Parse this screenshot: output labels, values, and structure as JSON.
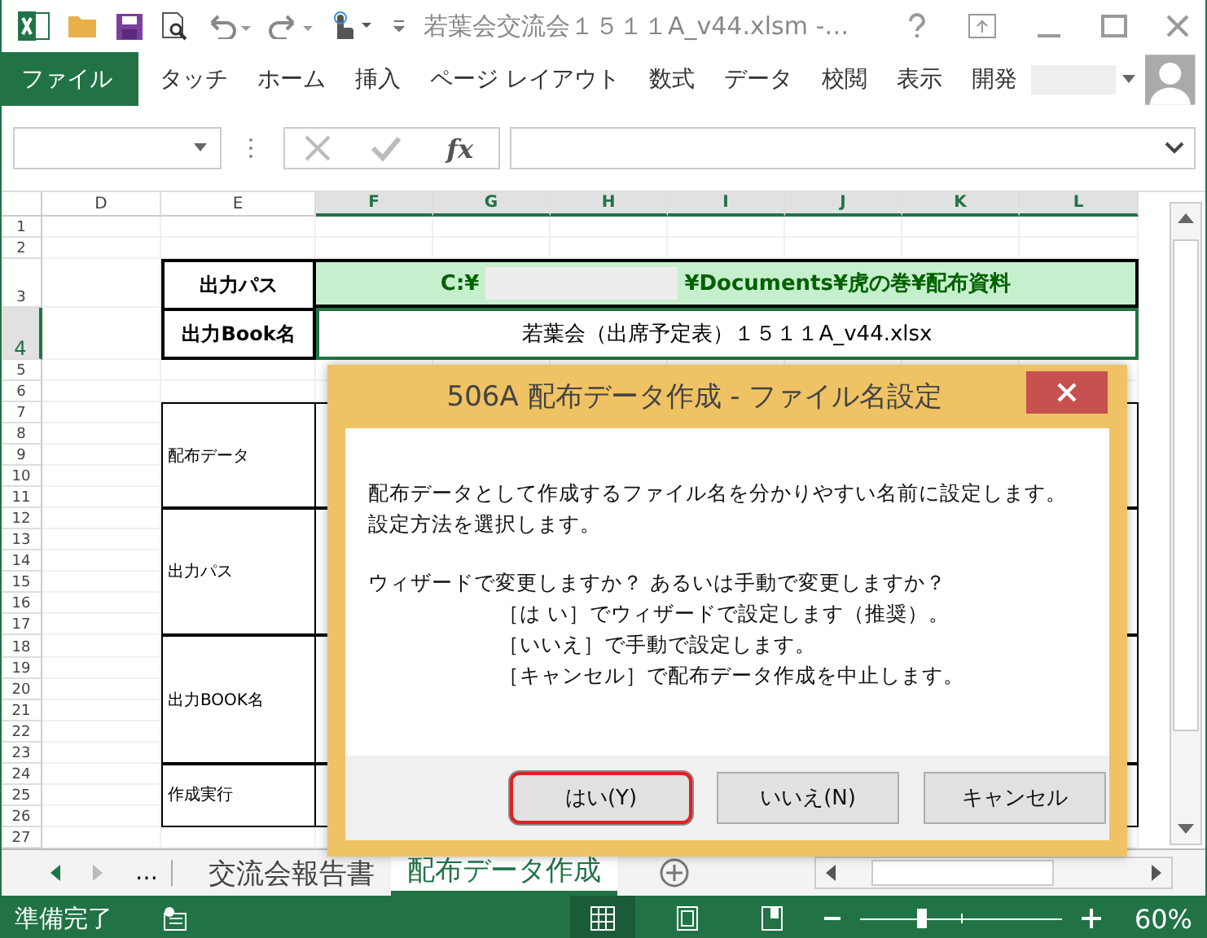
{
  "window": {
    "title": "若葉会交流会１５１１A_v44.xlsm -…"
  },
  "ribbon": {
    "tabs": [
      {
        "label": "ファイル",
        "kind": "file"
      },
      {
        "label": "タッチ",
        "kind": "tab"
      },
      {
        "label": "ホーム",
        "kind": "tab"
      },
      {
        "label": "挿入",
        "kind": "tab"
      },
      {
        "label": "ページ レイアウト",
        "kind": "tab"
      },
      {
        "label": "数式",
        "kind": "tab"
      },
      {
        "label": "データ",
        "kind": "tab"
      },
      {
        "label": "校閲",
        "kind": "tab"
      },
      {
        "label": "表示",
        "kind": "tab"
      },
      {
        "label": "開発",
        "kind": "tab"
      }
    ]
  },
  "formula_bar": {
    "fx": "fx"
  },
  "sheet": {
    "columns": [
      {
        "label": "D",
        "selected": false
      },
      {
        "label": "E",
        "selected": false
      },
      {
        "label": "F",
        "selected": true
      },
      {
        "label": "G",
        "selected": true
      },
      {
        "label": "H",
        "selected": true
      },
      {
        "label": "I",
        "selected": true
      },
      {
        "label": "J",
        "selected": true
      },
      {
        "label": "K",
        "selected": true
      },
      {
        "label": "L",
        "selected": true
      }
    ],
    "rows": [
      {
        "label": "1",
        "selected": false
      },
      {
        "label": "2",
        "selected": false
      },
      {
        "label": "3",
        "selected": false
      },
      {
        "label": "4",
        "selected": true
      },
      {
        "label": "5",
        "selected": false
      },
      {
        "label": "6",
        "selected": false
      },
      {
        "label": "7",
        "selected": false
      },
      {
        "label": "8",
        "selected": false
      },
      {
        "label": "9",
        "selected": false
      },
      {
        "label": "10",
        "selected": false
      },
      {
        "label": "11",
        "selected": false
      },
      {
        "label": "12",
        "selected": false
      },
      {
        "label": "13",
        "selected": false
      },
      {
        "label": "14",
        "selected": false
      },
      {
        "label": "15",
        "selected": false
      },
      {
        "label": "16",
        "selected": false
      },
      {
        "label": "17",
        "selected": false
      },
      {
        "label": "18",
        "selected": false
      },
      {
        "label": "19",
        "selected": false
      },
      {
        "label": "20",
        "selected": false
      },
      {
        "label": "21",
        "selected": false
      },
      {
        "label": "22",
        "selected": false
      },
      {
        "label": "23",
        "selected": false
      },
      {
        "label": "24",
        "selected": false
      },
      {
        "label": "25",
        "selected": false
      },
      {
        "label": "26",
        "selected": false
      },
      {
        "label": "27",
        "selected": false
      }
    ],
    "output_table": {
      "path_label": "出力パス",
      "path_start": "C:¥",
      "path_end": "¥Documents¥虎の巻¥配布資料",
      "book_label": "出力Book名",
      "book_value": "若葉会（出席予定表）１５１１A_v44.xlsx"
    },
    "description_table": [
      {
        "label": "配布データ"
      },
      {
        "label": "出力パス"
      },
      {
        "label": "出力BOOK名"
      },
      {
        "label": "作成実行"
      }
    ]
  },
  "sheet_tabs": [
    {
      "label": "…",
      "kind": "more"
    },
    {
      "label": "交流会報告書",
      "kind": "sheet",
      "selected": false
    },
    {
      "label": "配布データ作成",
      "kind": "sheet",
      "selected": true
    }
  ],
  "status_bar": {
    "status": "準備完了",
    "zoom": "60%",
    "level": 0.3
  },
  "dialog": {
    "title": "506A 配布データ作成 - ファイル名設定",
    "paragraphs": [
      {
        "lines": [
          {
            "text": "配布データとして作成するファイル名を分かりやすい名前に設定します。",
            "indented": false
          },
          {
            "text": "設定方法を選択します。",
            "indented": false
          }
        ]
      },
      {
        "lines": [
          {
            "text": "ウィザードで変更しますか？ あるいは手動で変更しますか？",
            "indented": false
          },
          {
            "text": "［は い］でウィザードで設定します（推奨）。",
            "indented": true
          },
          {
            "text": "［いいえ］で手動で設定します。",
            "indented": true
          },
          {
            "text": "［キャンセル］で配布データ作成を中止します。",
            "indented": true
          }
        ]
      }
    ],
    "buttons": [
      {
        "label": "はい(Y)",
        "selected": true
      },
      {
        "label": "いいえ(N)",
        "selected": false
      },
      {
        "label": "キャンセル",
        "selected": false
      }
    ]
  }
}
